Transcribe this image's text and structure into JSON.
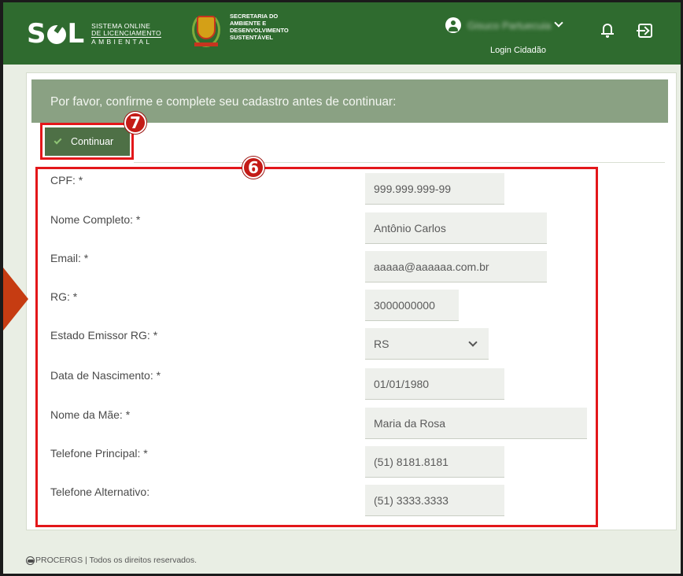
{
  "header": {
    "logo_letters": "SOL",
    "logo_line1": "SISTEMA  ONLINE",
    "logo_line2": "DE LICENCIAMENTO",
    "logo_line3": "AMBIENTAL",
    "secretaria_line1": "SECRETARIA DO",
    "secretaria_line2": "AMBIENTE E",
    "secretaria_line3": "DESENVOLVIMENTO",
    "secretaria_line4": "SUSTENTÁVEL",
    "user_name": "Gisuco Partuecuia",
    "login_label": "Login Cidadão",
    "icons": {
      "user": "user-circle-icon",
      "chevron": "chevron-down-icon",
      "bell": "bell-icon",
      "exit": "exit-icon"
    }
  },
  "banner": {
    "text": "Por favor, confirme e complete seu cadastro antes de continuar:"
  },
  "toolbar": {
    "continuar_label": "Continuar",
    "check_icon": "check-icon"
  },
  "markers": {
    "continuar": "7",
    "form": "6"
  },
  "form": {
    "fields": [
      {
        "label": "CPF:  *",
        "value": "999.999.999-99"
      },
      {
        "label": "Nome Completo:  *",
        "value": "Antônio Carlos"
      },
      {
        "label": "Email:  *",
        "value": "aaaaa@aaaaaa.com.br"
      },
      {
        "label": "RG:  *",
        "value": "3000000000"
      },
      {
        "label": "Estado Emissor RG:  *",
        "value": "RS"
      },
      {
        "label": "Data de Nascimento:  *",
        "value": "01/01/1980"
      },
      {
        "label": "Nome da Mãe:  *",
        "value": "Maria da Rosa"
      },
      {
        "label": "Telefone Principal:  *",
        "value": "(51) 8181.8181"
      },
      {
        "label": "Telefone Alternativo:",
        "value": "(51) 3333.3333"
      }
    ]
  },
  "footer": {
    "text": "PROCERGS | Todos os direitos reservados."
  },
  "colors": {
    "header": "#2f6b2f",
    "banner": "#8aa183",
    "button": "#4e7046",
    "highlight": "#e3171a",
    "marker": "#c41b17"
  }
}
